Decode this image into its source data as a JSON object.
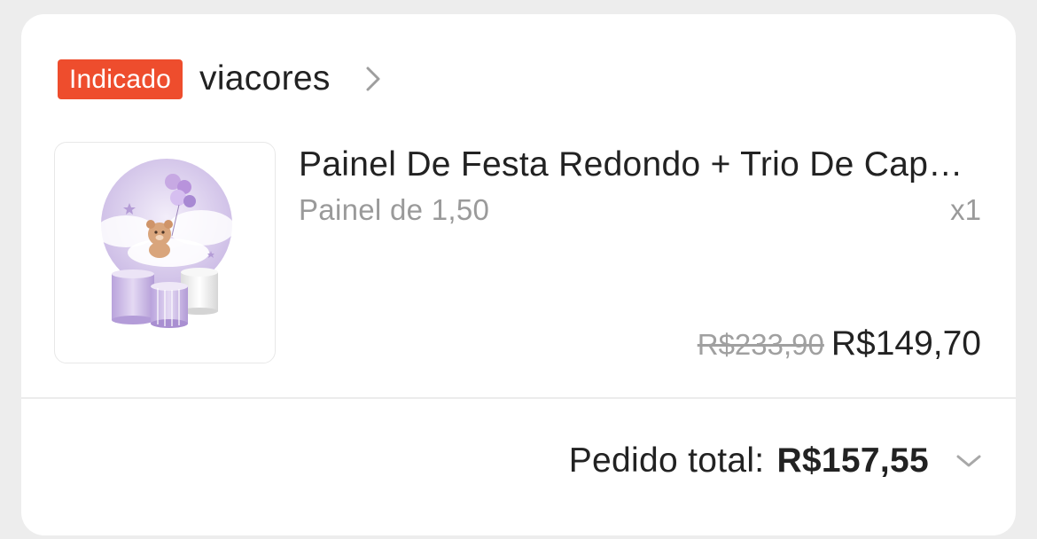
{
  "shop": {
    "badge": "Indicado",
    "name": "viacores",
    "chevron_icon": "chevron-right-icon"
  },
  "item": {
    "image_icon": "product-thumbnail",
    "title": "Painel De Festa Redondo + Trio De Capas Cilindro Urso Balão Lilás",
    "variant": "Painel de 1,50",
    "quantity": "x1",
    "original_price": "R$233,90",
    "price": "R$149,70"
  },
  "total": {
    "label": "Pedido total:",
    "value": "R$157,55",
    "expand_icon": "chevron-down-icon"
  },
  "colors": {
    "badge": "#ee4d2d",
    "text": "#222222",
    "muted": "#9a9a9a",
    "background": "#ededed",
    "card": "#ffffff"
  }
}
